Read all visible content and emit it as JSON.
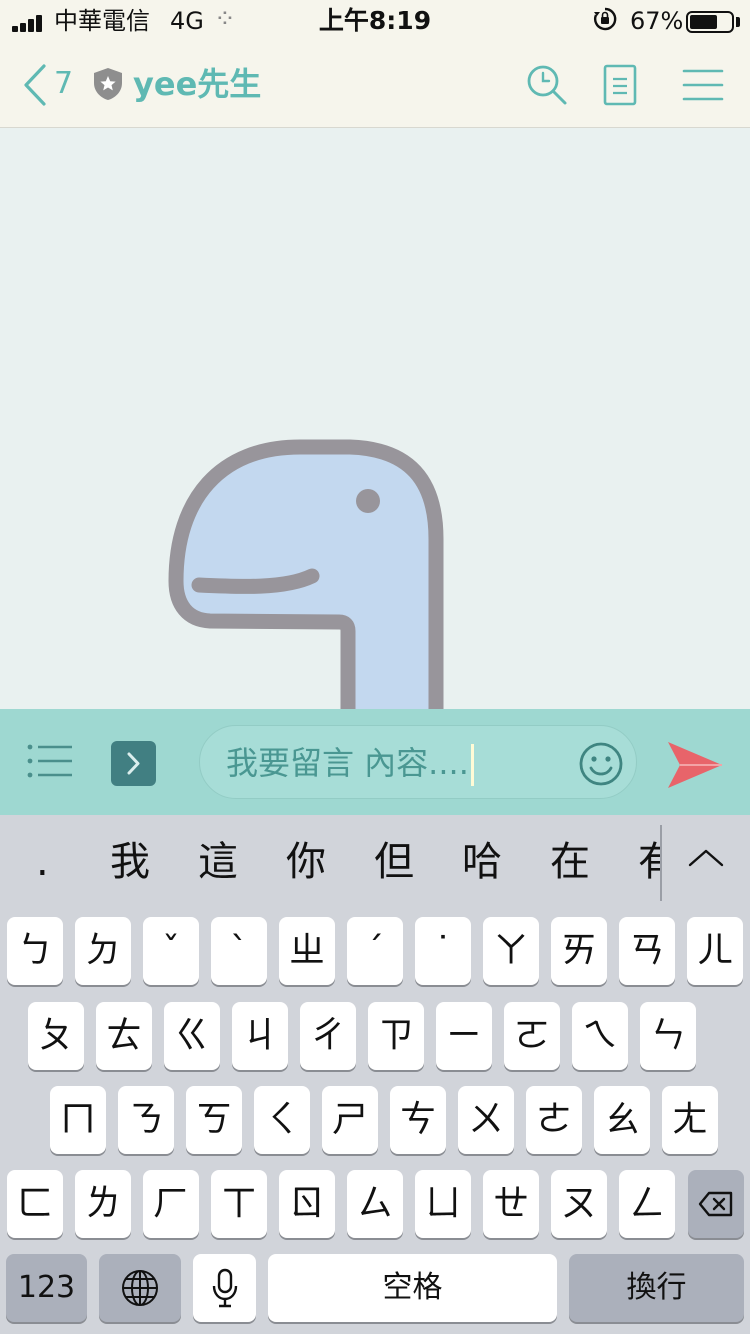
{
  "status_bar": {
    "carrier": "中華電信",
    "network": "4G",
    "time": "上午8:19",
    "battery_percent_text": "67%",
    "battery_level": 0.67
  },
  "header": {
    "back_count": "7",
    "title": "yee先生"
  },
  "composer": {
    "message_text": "我要留言 內容...."
  },
  "keyboard": {
    "candidates": [
      ".",
      "我",
      "這",
      "你",
      "但",
      "哈",
      "在",
      "有"
    ],
    "rows": [
      [
        "ㄅ",
        "ㄉ",
        "ˇ",
        "ˋ",
        "ㄓ",
        "ˊ",
        "˙",
        "ㄚ",
        "ㄞ",
        "ㄢ",
        "ㄦ"
      ],
      [
        "ㄆ",
        "ㄊ",
        "ㄍ",
        "ㄐ",
        "ㄔ",
        "ㄗ",
        "ㄧ",
        "ㄛ",
        "ㄟ",
        "ㄣ"
      ],
      [
        "ㄇ",
        "ㄋ",
        "ㄎ",
        "ㄑ",
        "ㄕ",
        "ㄘ",
        "ㄨ",
        "ㄜ",
        "ㄠ",
        "ㄤ"
      ],
      [
        "ㄈ",
        "ㄌ",
        "ㄏ",
        "ㄒ",
        "ㄖ",
        "ㄙ",
        "ㄩ",
        "ㄝ",
        "ㄡ",
        "ㄥ"
      ]
    ],
    "numbers_label": "123",
    "space_label": "空格",
    "return_label": "換行"
  },
  "colors": {
    "accent": "#5fb9b3",
    "header_bg": "#f6f5ec",
    "chat_bg": "#e9f1f0",
    "input_bar_bg": "#9ed8d1",
    "send": "#e8646a",
    "keyboard_bg": "#d1d4da"
  },
  "icons": {
    "back": "chevron-left-icon",
    "verified": "shield-star-icon",
    "search": "search-icon",
    "note": "note-icon",
    "menu": "hamburger-icon",
    "list": "list-icon",
    "expand": "chevron-right-icon",
    "emoji": "smiley-icon",
    "send": "paper-plane-icon",
    "globe": "globe-icon",
    "mic": "microphone-icon",
    "delete": "backspace-icon"
  }
}
